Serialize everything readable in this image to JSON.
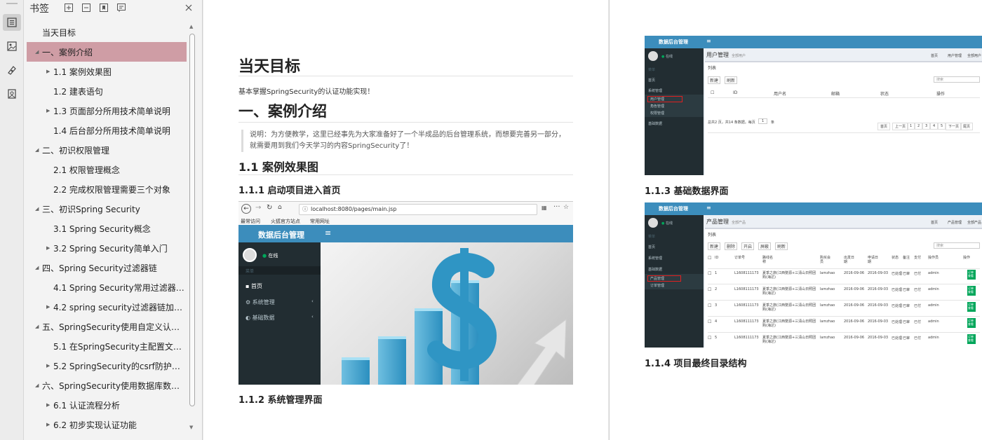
{
  "bookmarks_panel": {
    "title": "书签",
    "items": [
      {
        "label": "当天目标",
        "level": 0,
        "caret": "none"
      },
      {
        "label": "一、案例介绍",
        "level": 0,
        "caret": "open",
        "selected": true
      },
      {
        "label": "1.1 案例效果图",
        "level": 1,
        "caret": "closed"
      },
      {
        "label": "1.2 建表语句",
        "level": 1,
        "caret": "none"
      },
      {
        "label": "1.3 页面部分所用技术简单说明",
        "level": 1,
        "caret": "closed"
      },
      {
        "label": "1.4 后台部分所用技术简单说明",
        "level": 1,
        "caret": "none"
      },
      {
        "label": "二、初识权限管理",
        "level": 0,
        "caret": "open"
      },
      {
        "label": "2.1 权限管理概念",
        "level": 1,
        "caret": "none"
      },
      {
        "label": "2.2 完成权限管理需要三个对象",
        "level": 1,
        "caret": "none"
      },
      {
        "label": "三、初识Spring Security",
        "level": 0,
        "caret": "open"
      },
      {
        "label": "3.1 Spring Security概念",
        "level": 1,
        "caret": "none"
      },
      {
        "label": "3.2 Spring Security简单入门",
        "level": 1,
        "caret": "closed"
      },
      {
        "label": "四、Spring Security过滤器链",
        "level": 0,
        "caret": "open"
      },
      {
        "label": "4.1 Spring Security常用过滤器介绍",
        "level": 1,
        "caret": "none"
      },
      {
        "label": "4.2 spring security过滤器链加载...",
        "level": 1,
        "caret": "closed"
      },
      {
        "label": "五、SpringSecurity使用自定义认证...",
        "level": 0,
        "caret": "open"
      },
      {
        "label": "5.1 在SpringSecurity主配置文件...",
        "level": 1,
        "caret": "none"
      },
      {
        "label": "5.2 SpringSecurity的csrf防护机制",
        "level": 1,
        "caret": "closed"
      },
      {
        "label": "六、SpringSecurity使用数据库数据...",
        "level": 0,
        "caret": "open"
      },
      {
        "label": "6.1 认证流程分析",
        "level": 1,
        "caret": "closed"
      },
      {
        "label": "6.2 初步实现认证功能",
        "level": 1,
        "caret": "closed"
      }
    ]
  },
  "page1": {
    "h1": "当天目标",
    "intro": "基本掌握SpringSecurity的认证功能实现！",
    "h2": "一、案例介绍",
    "quote": "说明：为方便教学，这里已经事先为大家准备好了一个半成品的后台管理系统，而想要完善另一部分，就需要用到我们今天学习的内容SpringSecurity了！",
    "h3": "1.1 案例效果图",
    "h4": "1.1.1 启动项目进入首页",
    "h4b": "1.1.2 系统管理界面",
    "browser": {
      "url": "localhost:8080/pages/main.jsp",
      "bookmarks": [
        "最常访问",
        "火狐官方站点",
        "常用网址"
      ],
      "brand": "数据后台管理",
      "user_status": "在线",
      "menu_header": "菜单",
      "menu": [
        "首页",
        "系统管理",
        "基础数据"
      ]
    }
  },
  "page2": {
    "cap3": "1.1.3 基础数据界面",
    "cap4": "1.1.4 项目最终目录结构",
    "shotA": {
      "brand": "数据后台管理",
      "title": "用户管理",
      "subtitle": "全部用户",
      "list": "列表",
      "buttons": [
        "新建",
        "刷新"
      ],
      "columns": [
        "ID",
        "用户名",
        "邮箱",
        "状态",
        "操作"
      ],
      "side": [
        "在线",
        "菜单",
        "首页",
        "系统管理",
        "用户管理",
        "角色管理",
        "权限管理",
        "基础数据"
      ],
      "pager_text": "总共2 页，共14 条数据。每页",
      "pager_size": "1",
      "pager_unit": "条",
      "pages": [
        "首页",
        "上一页",
        "1",
        "2",
        "3",
        "4",
        "5",
        "下一页",
        "尾页"
      ],
      "crumbs": [
        "首页",
        "用户管理",
        "全部用户"
      ],
      "search": "搜索"
    },
    "shotB": {
      "brand": "数据后台管理",
      "title": "产品管理",
      "subtitle": "全部产品",
      "list": "列表",
      "buttons": [
        "新建",
        "删除",
        "开启",
        "屏蔽",
        "刷新"
      ],
      "columns": [
        "ID",
        "订单号",
        "路线名称",
        "购买会员",
        "出发日期",
        "申请日期",
        "状态",
        "备注",
        "支付",
        "操作员",
        "操作"
      ],
      "side": [
        "在线",
        "菜单",
        "首页",
        "系统管理",
        "基础数据",
        "产品管理",
        "订单管理"
      ],
      "rows": [
        {
          "id": "1",
          "order": "L1608111173",
          "route": "夏季之旅(江西婺源+三清山日照团购(海达)",
          "member": "lamzhao",
          "start": "2016-09-06",
          "apply": "2016-09-03",
          "status": "已处理",
          "note": "已审",
          "pay": "已付",
          "op": "admin"
        },
        {
          "id": "2",
          "order": "L1608111173",
          "route": "夏季之旅(江西婺源+三清山日照团购(海达)",
          "member": "lamzhao",
          "start": "2016-09-06",
          "apply": "2016-09-03",
          "status": "已处理",
          "note": "已审",
          "pay": "已付",
          "op": "admin"
        },
        {
          "id": "3",
          "order": "L1608111173",
          "route": "夏季之旅(江西婺源+三清山日照团购(海达)",
          "member": "lamzhao",
          "start": "2016-09-06",
          "apply": "2016-09-03",
          "status": "已处理",
          "note": "已审",
          "pay": "已付",
          "op": "admin"
        },
        {
          "id": "4",
          "order": "L1608111173",
          "route": "夏季之旅(江西婺源+三清山日照团购(海达)",
          "member": "lamzhao",
          "start": "2016-09-06",
          "apply": "2016-09-03",
          "status": "已处理",
          "note": "已审",
          "pay": "已付",
          "op": "admin"
        },
        {
          "id": "5",
          "order": "L1608111173",
          "route": "夏季之旅(江西婺源+三清山日照团购(海达)",
          "member": "lamzhao",
          "start": "2016-09-06",
          "apply": "2016-09-03",
          "status": "已处理",
          "note": "已审",
          "pay": "已付",
          "op": "admin"
        }
      ],
      "row_action": "订单查看",
      "crumbs": [
        "首页",
        "产品管理",
        "全部产品"
      ],
      "search": "搜索"
    }
  },
  "colors": {
    "accent_selected": "#cf9da5",
    "admin_blue": "#3c8dbc",
    "admin_dark": "#222d32"
  }
}
